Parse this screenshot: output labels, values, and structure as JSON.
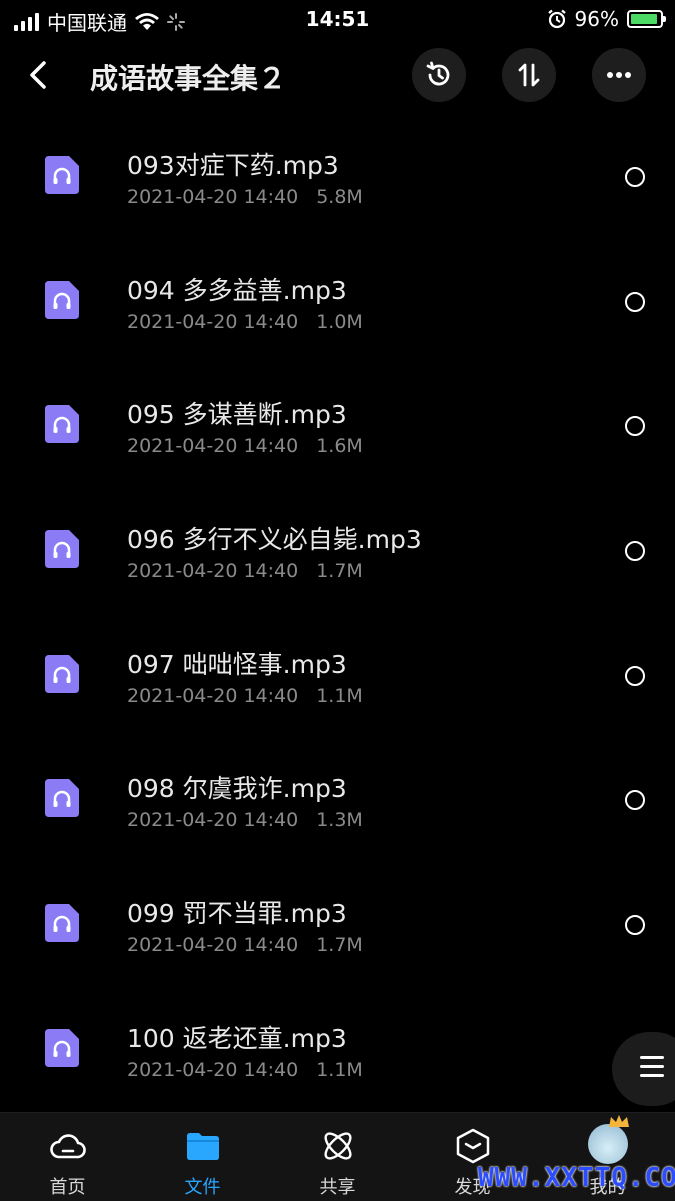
{
  "status": {
    "carrier": "中国联通",
    "time": "14:51",
    "battery_pct": "96%",
    "battery_color": "#4cd964"
  },
  "header": {
    "title": "成语故事全集２",
    "icons": [
      "back-icon",
      "history-icon",
      "sort-icon",
      "more-icon"
    ]
  },
  "files": [
    {
      "name": "093对症下药.mp3",
      "date": "2021-04-20 14:40",
      "size": "5.8M"
    },
    {
      "name": "094 多多益善.mp3",
      "date": "2021-04-20 14:40",
      "size": "1.0M"
    },
    {
      "name": "095 多谋善断.mp3",
      "date": "2021-04-20 14:40",
      "size": "1.6M"
    },
    {
      "name": "096 多行不义必自毙.mp3",
      "date": "2021-04-20 14:40",
      "size": "1.7M"
    },
    {
      "name": "097 咄咄怪事.mp3",
      "date": "2021-04-20 14:40",
      "size": "1.1M"
    },
    {
      "name": "098 尔虞我诈.mp3",
      "date": "2021-04-20 14:40",
      "size": "1.3M"
    },
    {
      "name": "099 罚不当罪.mp3",
      "date": "2021-04-20 14:40",
      "size": "1.7M"
    },
    {
      "name": "100 返老还童.mp3",
      "date": "2021-04-20 14:40",
      "size": "1.1M"
    }
  ],
  "tabs": [
    {
      "label": "首页",
      "icon": "cloud-icon"
    },
    {
      "label": "文件",
      "icon": "folder-icon",
      "active": true
    },
    {
      "label": "共享",
      "icon": "share-icon"
    },
    {
      "label": "发现",
      "icon": "discover-icon"
    },
    {
      "label": "我的",
      "icon": "avatar"
    }
  ],
  "watermark": "WWW.XXTTQ.COM",
  "accent": "#29a7ff",
  "file_icon_color": "#8b7cf6"
}
